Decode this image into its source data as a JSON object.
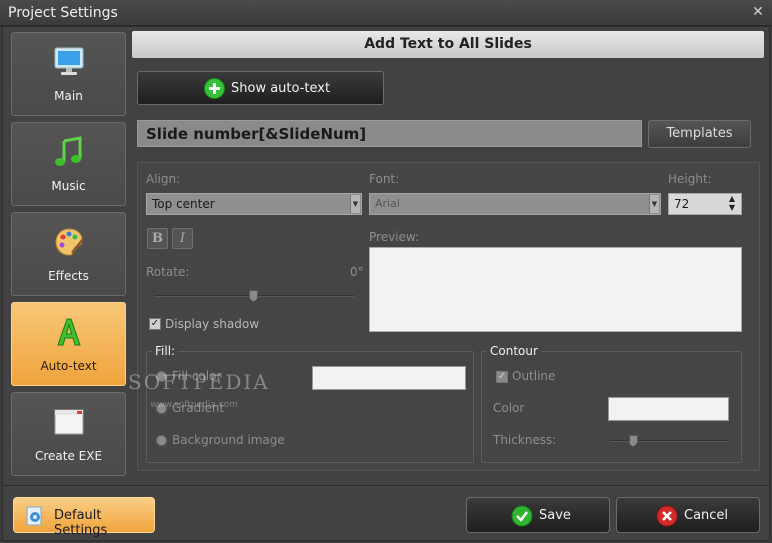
{
  "window": {
    "title": "Project Settings",
    "close_glyph": "✕"
  },
  "sidebar": {
    "items": [
      {
        "label": "Main",
        "icon": "monitor-icon"
      },
      {
        "label": "Music",
        "icon": "music-note-icon"
      },
      {
        "label": "Effects",
        "icon": "palette-icon"
      },
      {
        "label": "Auto-text",
        "icon": "letter-a-icon",
        "active": true
      },
      {
        "label": "Create EXE",
        "icon": "window-icon"
      }
    ]
  },
  "header": {
    "title": "Add Text to All Slides"
  },
  "autotext": {
    "show_label": "Show auto-text",
    "text_value": "Slide number[&SlideNum]",
    "templates_label": "Templates"
  },
  "format": {
    "align_label": "Align:",
    "align_value": "Top center",
    "font_label": "Font:",
    "font_value": "Arial",
    "height_label": "Height:",
    "height_value": "72",
    "bold_glyph": "B",
    "italic_glyph": "I",
    "preview_label": "Preview:",
    "rotate_label": "Rotate:",
    "rotate_value": "0°",
    "rotate_level": 0.5,
    "shadow_label": "Display shadow",
    "shadow_checked": true
  },
  "fill": {
    "title": "Fill:",
    "options": [
      "Fill color",
      "Gradient",
      "Background image"
    ]
  },
  "contour": {
    "title": "Contour",
    "outline_label": "Outline",
    "outline_checked": true,
    "color_label": "Color",
    "thickness_label": "Thickness:",
    "thickness_level": 0.2
  },
  "footer": {
    "default_label": "Default Settings",
    "save_label": "Save",
    "cancel_label": "Cancel"
  },
  "watermark": {
    "text": "SOFTPEDIA",
    "sub": "www.softpedia.com"
  },
  "colors": {
    "accent": "#f0a43d",
    "save": "#2fb52f",
    "cancel": "#d42a2a"
  }
}
